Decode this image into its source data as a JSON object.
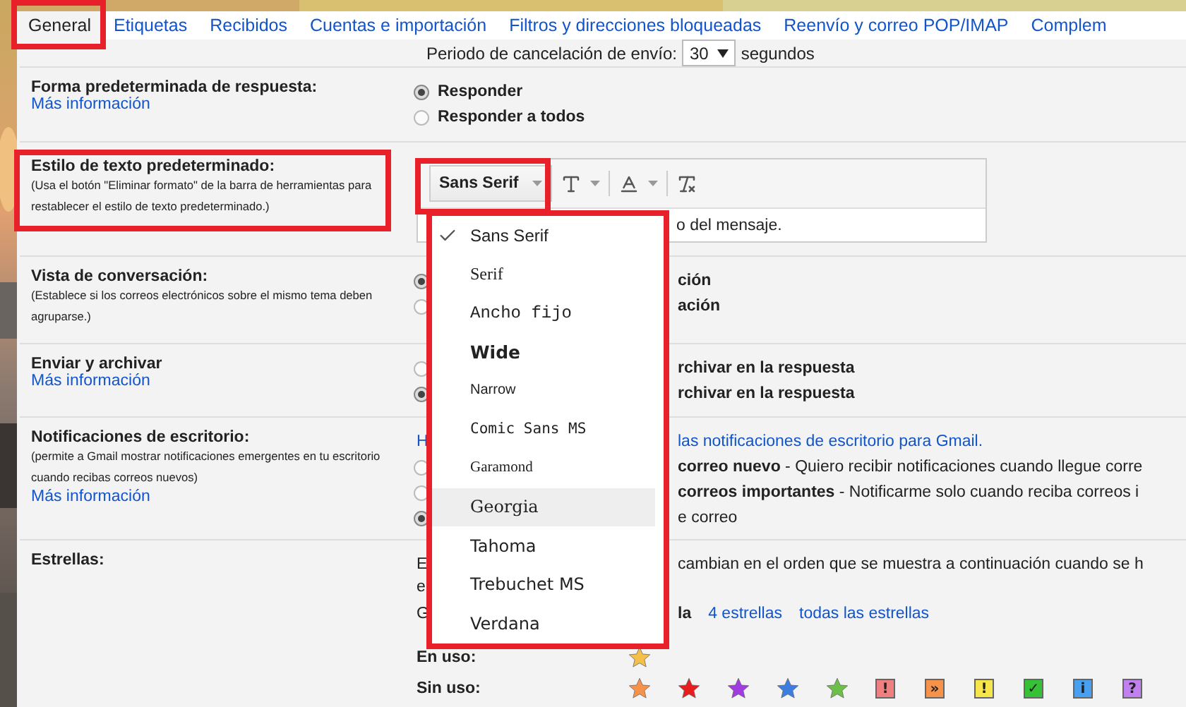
{
  "tabs": [
    {
      "label": "General",
      "selected": true
    },
    {
      "label": "Etiquetas",
      "selected": false
    },
    {
      "label": "Recibidos",
      "selected": false
    },
    {
      "label": "Cuentas e importación",
      "selected": false
    },
    {
      "label": "Filtros y direcciones bloqueadas",
      "selected": false
    },
    {
      "label": "Reenvío y correo POP/IMAP",
      "selected": false
    },
    {
      "label": "Complem",
      "selected": false
    }
  ],
  "undo_send": {
    "label": "Periodo de cancelación de envío:",
    "value": "30",
    "unit": "segundos"
  },
  "settings": [
    {
      "kind": "radios",
      "title": "Forma predeterminada de respuesta:",
      "link": "Más información",
      "options": [
        {
          "label": "Responder",
          "selected": true
        },
        {
          "label": "Responder a todos",
          "selected": false
        }
      ]
    },
    {
      "kind": "editor",
      "title": "Estilo de texto predeterminado:",
      "note": "(Usa el botón \"Eliminar formato\" de la barra de herramientas para restablecer el estilo de texto predeterminado.)",
      "font_button": "Sans Serif",
      "preview": "o del mensaje."
    },
    {
      "kind": "radios",
      "title": "Vista de conversación:",
      "note": "(Establece si los correos electrónicos sobre el mismo tema deben agruparse.)",
      "options": [
        {
          "label": "ción",
          "selected": true
        },
        {
          "label": "ación",
          "selected": false
        }
      ]
    },
    {
      "kind": "radios",
      "title": "Enviar y archivar",
      "link": "Más información",
      "options": [
        {
          "label": "rchivar en la respuesta",
          "selected": false
        },
        {
          "label": "rchivar en la respuesta",
          "selected": true
        }
      ]
    },
    {
      "kind": "notifications",
      "title": "Notificaciones de escritorio:",
      "note": "(permite a Gmail mostrar notificaciones emergentes en tu escritorio cuando recibas correos nuevos)",
      "link": "Más información",
      "lead": "H",
      "lead_link": "las notificaciones de escritorio para Gmail.",
      "options": [
        {
          "label": "**correo nuevo** - Quiero recibir notificaciones cuando llegue corre",
          "selected": false
        },
        {
          "label": "**correos importantes** - Notificarme solo cuando reciba correos i",
          "selected": false
        },
        {
          "label": "e correo",
          "selected": true
        }
      ]
    },
    {
      "kind": "stars",
      "title": "Estrellas:",
      "lead_1": "E",
      "text_1": "cambian en el orden que se muestra a continuación cuando se h",
      "lead_2": "e",
      "lead_3": "G",
      "bold_3": "la",
      "links": [
        "4 estrellas",
        "todas las estrellas"
      ],
      "in_use": {
        "label": "En uso:",
        "icons": [
          {
            "kind": "star",
            "color": "#f5c04a"
          }
        ]
      },
      "not_in_use": {
        "label": "Sin uso:",
        "icons": [
          {
            "kind": "star",
            "color": "#f7924a"
          },
          {
            "kind": "star",
            "color": "#e61e1e"
          },
          {
            "kind": "star",
            "color": "#a03ce0"
          },
          {
            "kind": "star",
            "color": "#3c7ee0"
          },
          {
            "kind": "star",
            "color": "#6cc04a"
          },
          {
            "kind": "box",
            "color": "#f08080",
            "glyph": "!"
          },
          {
            "kind": "box",
            "color": "#f7924a",
            "glyph": "»"
          },
          {
            "kind": "box",
            "color": "#f7e64a",
            "glyph": "!"
          },
          {
            "kind": "box",
            "color": "#36c236",
            "glyph": "✓"
          },
          {
            "kind": "box",
            "color": "#4aa0f0",
            "glyph": "i"
          },
          {
            "kind": "box",
            "color": "#c080f0",
            "glyph": "?"
          }
        ]
      }
    }
  ],
  "font_menu": {
    "items": [
      {
        "label": "Sans Serif",
        "checked": true,
        "highlighted": false
      },
      {
        "label": "Serif",
        "checked": false,
        "highlighted": false
      },
      {
        "label": "Ancho fijo",
        "checked": false,
        "highlighted": false
      },
      {
        "label": "Wide",
        "checked": false,
        "highlighted": false
      },
      {
        "label": "Narrow",
        "checked": false,
        "highlighted": false
      },
      {
        "label": "Comic Sans MS",
        "checked": false,
        "highlighted": false
      },
      {
        "label": "Garamond",
        "checked": false,
        "highlighted": false
      },
      {
        "label": "Georgia",
        "checked": false,
        "highlighted": true
      },
      {
        "label": "Tahoma",
        "checked": false,
        "highlighted": false
      },
      {
        "label": "Trebuchet MS",
        "checked": false,
        "highlighted": false
      },
      {
        "label": "Verdana",
        "checked": false,
        "highlighted": false
      }
    ]
  }
}
